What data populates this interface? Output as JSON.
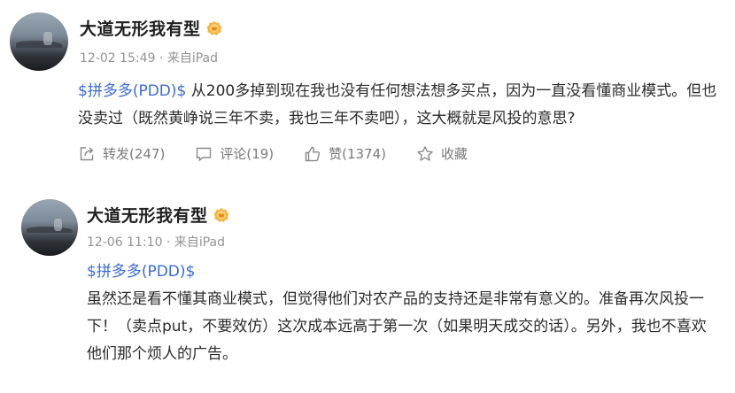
{
  "posts": [
    {
      "user": {
        "name": "大道无形我有型"
      },
      "meta": "12-02 15:49 · 来自iPad",
      "topic": "$拼多多(PDD)$",
      "text": " 从200多掉到现在我也没有任何想法想多买点，因为一直没看懂商业模式。但也没卖过（既然黄峥说三年不卖，我也三年不卖吧），这大概就是风投的意思?",
      "actions": {
        "repost": "转发(247)",
        "comment": "评论(19)",
        "like": "赞(1374)",
        "favorite": "收藏"
      }
    },
    {
      "user": {
        "name": "大道无形我有型"
      },
      "meta": "12-06 11:10 · 来自iPad",
      "topic": "$拼多多(PDD)$",
      "text": "虽然还是看不懂其商业模式，但觉得他们对农产品的支持还是非常有意义的。准备再次风投一下！（卖点put，不要效仿）这次成本远高于第一次（如果明天成交的话）。另外，我也不喜欢他们那个烦人的广告。"
    }
  ],
  "colors": {
    "topic": "#3a6bd8",
    "meta": "#939393",
    "action": "#7a7a7a",
    "badge": "#f4b53f"
  },
  "icons": [
    "vip-badge-icon",
    "repost-icon",
    "comment-icon",
    "like-icon",
    "star-icon"
  ]
}
